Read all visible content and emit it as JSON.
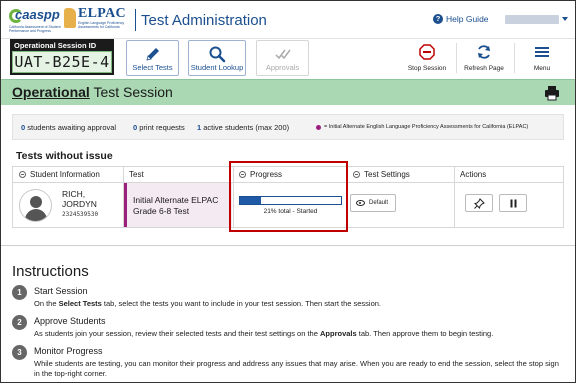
{
  "header": {
    "logo_caaspp": "caaspp",
    "logo_caaspp_tag": "California Assessment of Student Performance and Progress",
    "logo_elpac": "ELPAC",
    "logo_elpac_tag": "English Language Proficiency Assessments for California",
    "app_title": "Test Administration",
    "help_label": "Help Guide",
    "help_icon": "question-circle-icon"
  },
  "toolbar": {
    "session_id_label": "Operational Session ID",
    "session_id": "UAT-B25E-4",
    "select_tests": "Select Tests",
    "student_lookup": "Student Lookup",
    "approvals": "Approvals",
    "stop_session": "Stop Session",
    "refresh_page": "Refresh Page",
    "menu": "Menu"
  },
  "banner": {
    "title_emphasis": "Operational",
    "title_rest": "Test Session",
    "color": "#a9d8b3"
  },
  "stats": {
    "awaiting_count": "0",
    "awaiting_label": "students awaiting approval",
    "print_count": "0",
    "print_label": "print requests",
    "active_count": "1",
    "active_label": "active students (max 200)",
    "legend": "= Initial Alternate English Language Proficiency Assessments for California (ELPAC)",
    "legend_color": "#9b1f7d"
  },
  "table": {
    "section_title": "Tests without issue",
    "headers": [
      "Student Information",
      "Test",
      "Progress",
      "Test Settings",
      "Actions"
    ],
    "rows": [
      {
        "name_last": "RICH,",
        "name_first": "JORDYN",
        "ssid": "2324539530",
        "test_line1": "Initial Alternate ELPAC",
        "test_line2": "Grade 6-8 Test",
        "progress_percent": 21,
        "progress_text": "21% total  -  Started",
        "settings_label": "Default"
      }
    ]
  },
  "instructions": {
    "title": "Instructions",
    "steps": [
      {
        "num": "1",
        "heading": "Start Session",
        "desc_parts": [
          "On the ",
          "Select Tests",
          " tab, select the tests you want to include in your test session. Then start the session."
        ]
      },
      {
        "num": "2",
        "heading": "Approve Students",
        "desc_parts": [
          "As students join your session, review their selected tests and their test settings on the ",
          "Approvals",
          " tab. Then approve them to begin testing."
        ]
      },
      {
        "num": "3",
        "heading": "Monitor Progress",
        "desc_parts": [
          "While students are testing, you can monitor their progress and address any issues that may arise. When you are ready to end the session, select the stop sign in the top-right corner."
        ]
      }
    ]
  },
  "colors": {
    "brand_blue": "#1b4f8f",
    "highlight_red": "#c00000"
  }
}
